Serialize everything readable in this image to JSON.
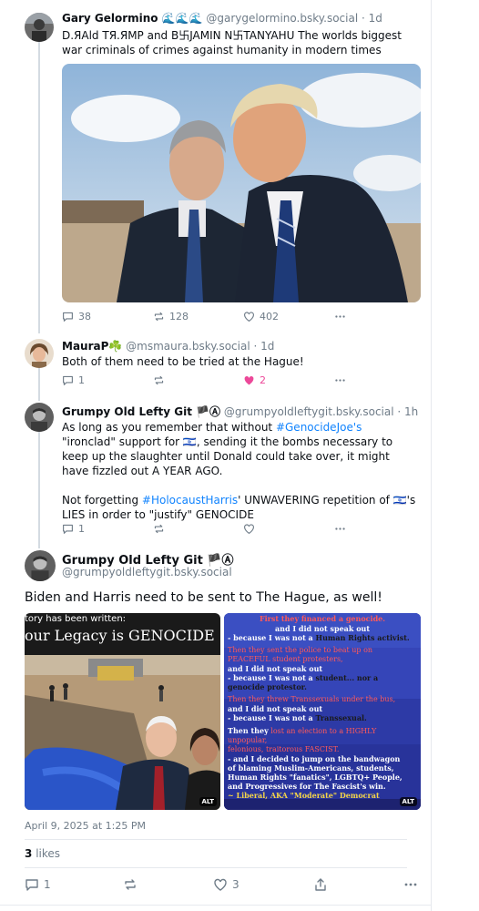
{
  "posts": [
    {
      "name": "Gary Gelormino 🌊🌊🌊",
      "handle": "@garygelormino.bsky.social",
      "time": "· 1d",
      "text": "D.ЯAld TЯ.ЯMP and B卐JAMIN N卐TANYAHU The worlds biggest war criminals of crimes against humanity in modern times",
      "replies": "38",
      "reposts": "128",
      "likes": "402"
    },
    {
      "name": "MauraP☘️",
      "handle": "@msmaura.bsky.social",
      "time": "· 1d",
      "text": "Both of them need to be tried at the Hague!",
      "replies": "1",
      "reposts": "",
      "likes": "2"
    },
    {
      "name": "Grumpy Old Lefty Git 🏴Ⓐ",
      "handle": "@grumpyoldleftygit.bsky.social",
      "time": "· 1h",
      "text_parts": {
        "a": "As long as you remember that without ",
        "tag1": "#GenocideJoe's",
        "b": " \"ironclad\" support for 🇮🇱, sending it the bombs necessary to keep up the slaughter until Donald could take over, it might have fizzled out A YEAR AGO.",
        "c": "Not forgetting ",
        "tag2": "#HolocaustHarris",
        "d": "' UNWAVERING repetition of 🇮🇱's LIES in order to \"justify\" GENOCIDE"
      },
      "replies": "1",
      "reposts": "",
      "likes": ""
    }
  ],
  "main_post": {
    "name": "Grumpy Old Lefty Git 🏴Ⓐ",
    "handle": "@grumpyoldleftygit.bsky.social",
    "text": "Biden and Harris need to be sent to The Hague, as well!",
    "image_left": {
      "line1": "tory has been written:",
      "line2": "our Legacy is GENOCIDE",
      "alt": "ALT"
    },
    "image_right": {
      "lines": [
        "First they financed a genocide.",
        "and I did not speak out",
        "- because I was not a",
        "Human Rights activist.",
        "Then they sent the police to beat up on",
        "PEACEFUL student protesters,",
        "and I did not speak out",
        "- because I was not a",
        "student... nor a genocide protestor.",
        "Then they threw Transsexuals under the bus,",
        "and I did not speak out",
        "- because I was not a",
        "Transsexual.",
        "Then they",
        "lost an election to a HIGHLY unpopular,",
        "felonious, traitorous FASCIST.",
        "- and I decided to jump on the bandwagon",
        "of blaming Muslim-Americans, students,",
        "Human Rights \"fanatics\", LGBTQ+ People,",
        "and Progressives for The Fascist's win.",
        "~ Liberal, AKA \"Moderate\" Democrat"
      ],
      "alt": "ALT"
    },
    "timestamp": "April 9, 2025 at 1:25 PM",
    "likes_count": "3",
    "likes_label": "likes",
    "replies": "1",
    "reposts": "",
    "likes": "3"
  },
  "photo1_alt": "",
  "colors": {
    "accent": "#1083fe",
    "like": "#ec4899",
    "muted": "#6f7c88"
  }
}
